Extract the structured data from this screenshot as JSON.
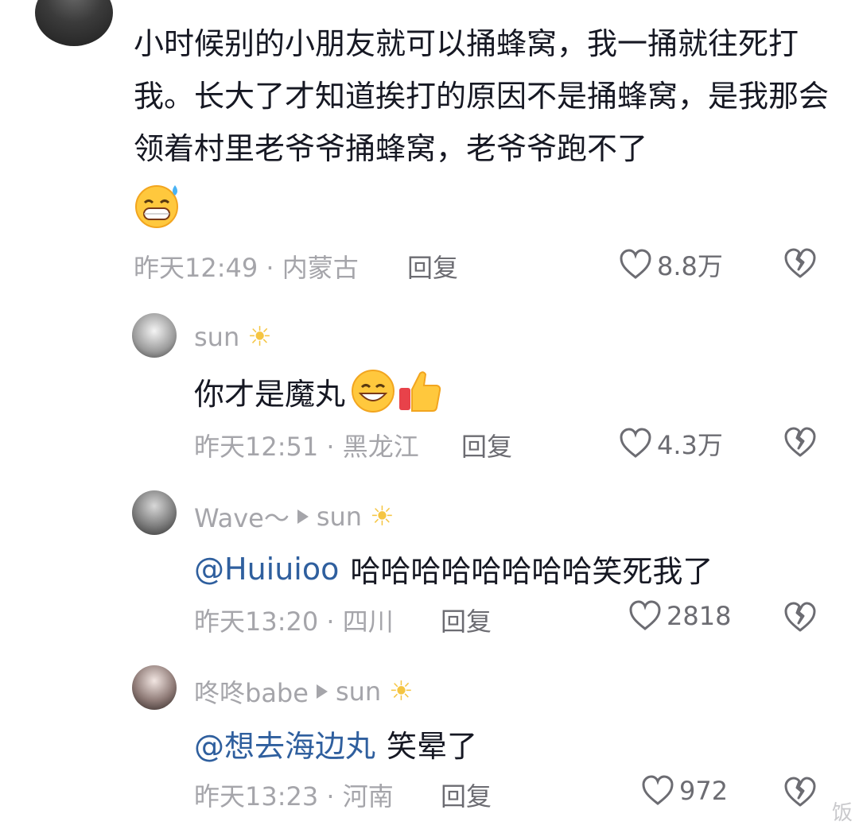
{
  "main_comment": {
    "text": "小时候别的小朋友就可以捅蜂窝，我一捅就往死打我。长大了才知道挨打的原因不是捅蜂窝，是我那会领着村里老爷爷捅蜂窝，老爷爷跑不了",
    "time": "昨天12:49",
    "location": "内蒙古",
    "reply_label": "回复",
    "likes": "8.8万",
    "emoji": "sweat-grin-emoji"
  },
  "replies": [
    {
      "user": "sun",
      "text": "你才是魔丸",
      "time": "昨天12:51",
      "location": "黑龙江",
      "reply_label": "回复",
      "likes": "4.3万"
    },
    {
      "user": "Wave～",
      "reply_to": "sun",
      "mention": "@Huiuioo",
      "text": "哈哈哈哈哈哈哈哈笑死我了",
      "time": "昨天13:20",
      "location": "四川",
      "reply_label": "回复",
      "likes": "2818"
    },
    {
      "user": "咚咚babe",
      "reply_to": "sun",
      "mention": "@想去海边丸",
      "text": "笑晕了",
      "time": "昨天13:23",
      "location": "河南",
      "reply_label": "回复",
      "likes": "972"
    }
  ],
  "watermark": "饭",
  "colors": {
    "text": "#161823",
    "meta": "#a5a5aa",
    "mention": "#2f5f9e",
    "icon": "#6c6c72"
  }
}
